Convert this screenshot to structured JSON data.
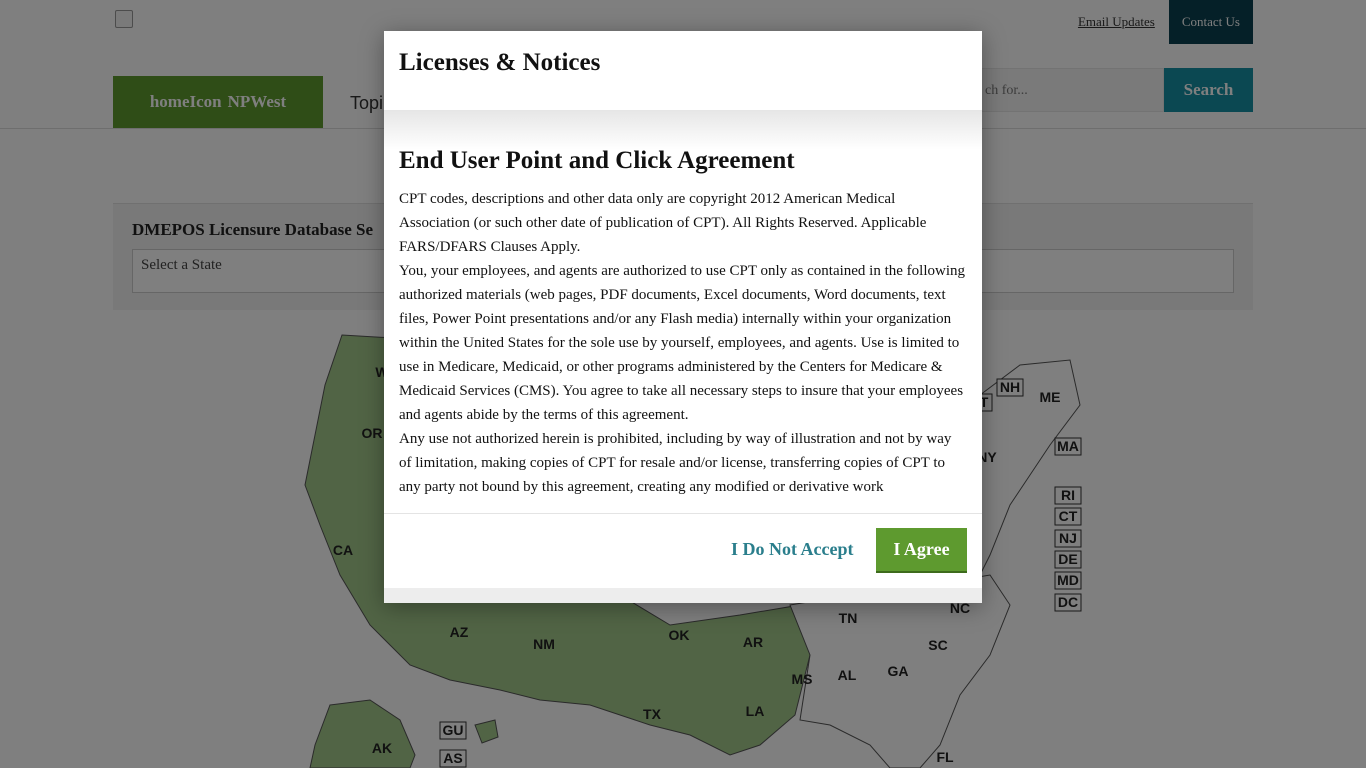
{
  "header": {
    "email_link": "Email Updates",
    "contact_button": "Contact Us",
    "home_tab": {
      "icon_alt": "homeIcon",
      "label": "NPWest"
    },
    "nav_topics": "Topi",
    "search_placeholder": "ch for...",
    "search_button": "Search"
  },
  "state_panel": {
    "label": "DMEPOS Licensure Database Se",
    "select_value": "Select a State"
  },
  "map": {
    "labels": {
      "WA": "W",
      "OR": "OR",
      "CA": "CA",
      "AZ": "AZ",
      "NM": "NM",
      "OK": "OK",
      "AR": "AR",
      "TX": "TX",
      "LA": "LA",
      "MS": "MS",
      "AL": "AL",
      "GA": "GA",
      "SC": "SC",
      "NC": "NC",
      "TN": "TN",
      "FL": "FL",
      "AK": "AK",
      "GU": "GU",
      "AS": "AS",
      "NY": "NY",
      "ME": "ME",
      "NH": "NH",
      "VT": "T",
      "MA": "MA",
      "RI": "RI",
      "CT": "CT",
      "NJ": "NJ",
      "DE": "DE",
      "MD": "MD",
      "DC": "DC"
    },
    "colors": {
      "active": "#a2c98a",
      "inactive": "#ffffff",
      "outline": "#555555"
    }
  },
  "modal": {
    "title": "Licenses & Notices",
    "heading": "End User Point and Click Agreement",
    "paragraphs": [
      "CPT codes, descriptions and other data only are copyright 2012 American Medical Association (or such other date of publication of CPT). All Rights Reserved. Applicable FARS/DFARS Clauses Apply.",
      "You, your employees, and agents are authorized to use CPT only as contained in the following authorized materials (web pages, PDF documents, Excel documents, Word documents, text files, Power Point presentations and/or any Flash media) internally within your organization within the United States for the sole use by yourself, employees, and agents. Use is limited to use in Medicare, Medicaid, or other programs administered by the Centers for Medicare & Medicaid Services (CMS). You agree to take all necessary steps to insure that your employees and agents abide by the terms of this agreement.",
      "Any use not authorized herein is prohibited, including by way of illustration and not by way of limitation, making copies of CPT for resale and/or license, transferring copies of CPT to any party not bound by this agreement, creating any modified or derivative work"
    ],
    "decline_button": "I Do Not Accept",
    "agree_button": "I Agree"
  }
}
